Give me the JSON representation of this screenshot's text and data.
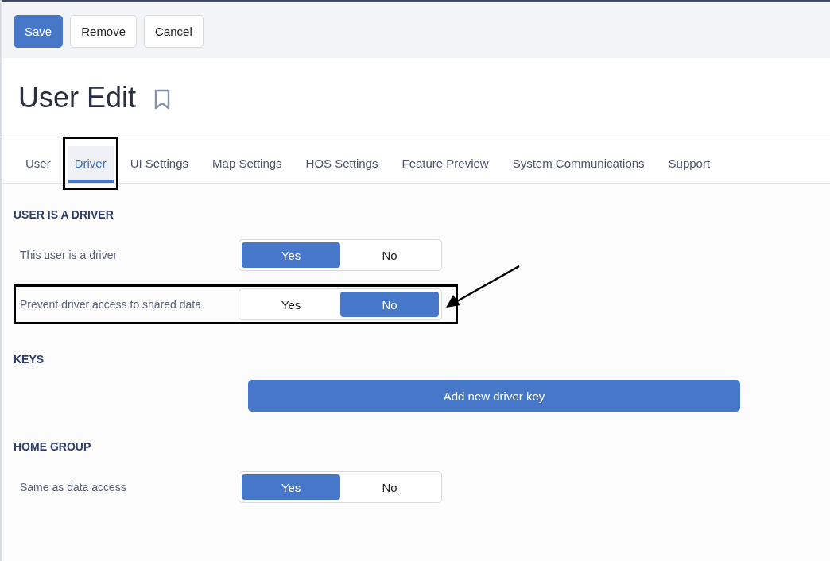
{
  "toolbar": {
    "buttons": [
      {
        "label": "Save",
        "kind": "primary"
      },
      {
        "label": "Remove",
        "kind": "secondary"
      },
      {
        "label": "Cancel",
        "kind": "secondary"
      }
    ]
  },
  "title": "User Edit",
  "tabs": [
    {
      "label": "User",
      "selected": false,
      "highlighted": false
    },
    {
      "label": "Driver",
      "selected": true,
      "highlighted": true
    },
    {
      "label": "UI Settings",
      "selected": false,
      "highlighted": false
    },
    {
      "label": "Map Settings",
      "selected": false,
      "highlighted": false
    },
    {
      "label": "HOS Settings",
      "selected": false,
      "highlighted": false
    },
    {
      "label": "Feature Preview",
      "selected": false,
      "highlighted": false
    },
    {
      "label": "System Communications",
      "selected": false,
      "highlighted": false
    },
    {
      "label": "Support",
      "selected": false,
      "highlighted": false
    }
  ],
  "sections": [
    {
      "heading": "USER IS A DRIVER",
      "kind": "toggles",
      "rows": [
        {
          "label": "This user is a driver",
          "highlighted": false,
          "options": [
            {
              "label": "Yes",
              "selected": true
            },
            {
              "label": "No",
              "selected": false
            }
          ]
        },
        {
          "label": "Prevent driver access to shared data",
          "highlighted": true,
          "options": [
            {
              "label": "Yes",
              "selected": false
            },
            {
              "label": "No",
              "selected": true
            }
          ]
        }
      ]
    },
    {
      "heading": "KEYS",
      "kind": "button",
      "button": "Add new driver key"
    },
    {
      "heading": "HOME GROUP",
      "kind": "toggles",
      "rows": [
        {
          "label": "Same as data access",
          "highlighted": false,
          "options": [
            {
              "label": "Yes",
              "selected": true
            },
            {
              "label": "No",
              "selected": false
            }
          ]
        }
      ]
    }
  ],
  "annotation_arrow": true
}
